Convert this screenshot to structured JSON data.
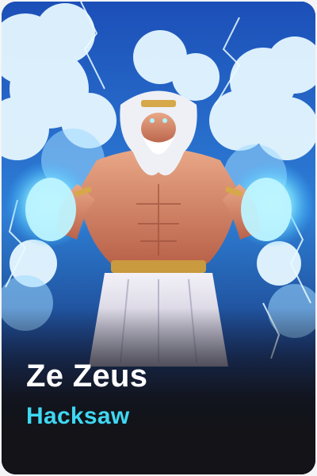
{
  "card": {
    "title": "Ze Zeus",
    "provider": "Hacksaw",
    "artwork_icon": "zeus-illustration-icon"
  },
  "colors": {
    "title_text": "#ffffff",
    "provider_text": "#3fd7f2",
    "caption_background": "#131318",
    "sky": "#1c4fb8"
  }
}
